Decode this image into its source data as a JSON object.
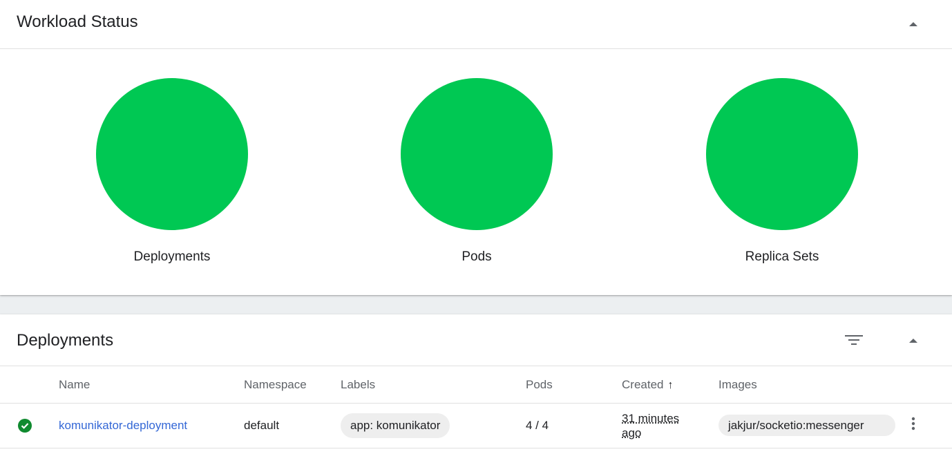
{
  "workload_status": {
    "title": "Workload Status",
    "items": [
      {
        "label": "Deployments",
        "color": "#00c853"
      },
      {
        "label": "Pods",
        "color": "#00c853"
      },
      {
        "label": "Replica Sets",
        "color": "#00c853"
      }
    ]
  },
  "deployments": {
    "title": "Deployments",
    "columns": {
      "name": "Name",
      "namespace": "Namespace",
      "labels": "Labels",
      "pods": "Pods",
      "created": "Created",
      "images": "Images"
    },
    "sort_icon": "arrow-up-icon",
    "rows": [
      {
        "status_icon": "check-circle-icon",
        "name": "komunikator-deployment",
        "namespace": "default",
        "label": "app: komunikator",
        "pods": "4 / 4",
        "created": "31 minutes ago",
        "image": "jakjur/socketio:messenger"
      }
    ]
  },
  "colors": {
    "accent": "#3367d6",
    "success": "#0f8a2f",
    "status_circle": "#00c853"
  }
}
